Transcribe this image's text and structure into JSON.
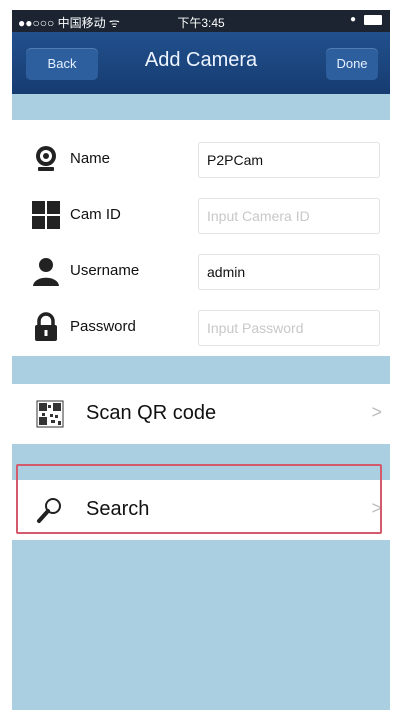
{
  "status_bar": {
    "carrier": "●●○○○ 中国移动 ᯤ",
    "time": "下午3:45"
  },
  "nav": {
    "back_label": "Back",
    "title": "Add Camera",
    "done_label": "Done"
  },
  "form": {
    "name": {
      "label": "Name",
      "value": "P2PCam",
      "placeholder": ""
    },
    "cam_id": {
      "label": "Cam ID",
      "value": "",
      "placeholder": "Input Camera ID"
    },
    "username": {
      "label": "Username",
      "value": "admin",
      "placeholder": ""
    },
    "password": {
      "label": "Password",
      "value": "",
      "placeholder": "Input Password"
    }
  },
  "actions": {
    "scan_qr": {
      "label": "Scan QR code",
      "chevron": ">"
    },
    "search": {
      "label": "Search",
      "chevron": ">"
    }
  },
  "colors": {
    "nav_blue": "#1f4d89",
    "background": "#a9cfe0",
    "highlight_border": "#d35a6b"
  }
}
